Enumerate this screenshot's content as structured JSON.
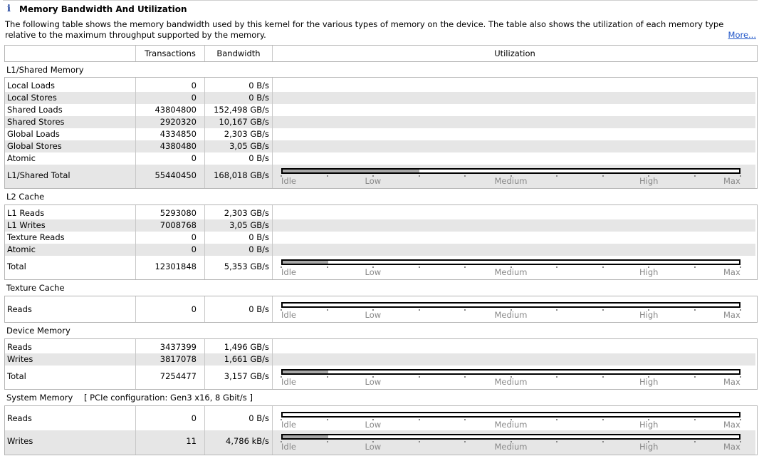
{
  "section": {
    "icon": "info-icon",
    "icon_glyph": "i",
    "title": "Memory Bandwidth And Utilization",
    "description": "The following table shows the memory bandwidth used by this kernel for the various types of memory on the device. The table also shows the utilization of each memory type relative to the maximum throughput supported by the memory.",
    "more_link": "More..."
  },
  "columns": {
    "transactions": "Transactions",
    "bandwidth": "Bandwidth",
    "utilization": "Utilization"
  },
  "scale_labels": {
    "idle": "Idle",
    "low": "Low",
    "medium": "Medium",
    "high": "High",
    "max": "Max"
  },
  "groups": {
    "l1": {
      "title": "L1/Shared Memory",
      "rows": [
        {
          "name": "Local Loads",
          "transactions": "0",
          "bandwidth": "0 B/s"
        },
        {
          "name": "Local Stores",
          "transactions": "0",
          "bandwidth": "0 B/s"
        },
        {
          "name": "Shared Loads",
          "transactions": "43804800",
          "bandwidth": "152,498 GB/s"
        },
        {
          "name": "Shared Stores",
          "transactions": "2920320",
          "bandwidth": "10,167 GB/s"
        },
        {
          "name": "Global Loads",
          "transactions": "4334850",
          "bandwidth": "2,303 GB/s"
        },
        {
          "name": "Global Stores",
          "transactions": "4380480",
          "bandwidth": "3,05 GB/s"
        },
        {
          "name": "Atomic",
          "transactions": "0",
          "bandwidth": "0 B/s"
        }
      ],
      "total": {
        "name": "L1/Shared Total",
        "transactions": "55440450",
        "bandwidth": "168,018 GB/s",
        "utilization": 0.3
      }
    },
    "l2": {
      "title": "L2 Cache",
      "rows": [
        {
          "name": "L1 Reads",
          "transactions": "5293080",
          "bandwidth": "2,303 GB/s"
        },
        {
          "name": "L1 Writes",
          "transactions": "7008768",
          "bandwidth": "3,05 GB/s"
        },
        {
          "name": "Texture Reads",
          "transactions": "0",
          "bandwidth": "0 B/s"
        },
        {
          "name": "Atomic",
          "transactions": "0",
          "bandwidth": "0 B/s"
        }
      ],
      "total": {
        "name": "Total",
        "transactions": "12301848",
        "bandwidth": "5,353 GB/s",
        "utilization": 0.1
      }
    },
    "tex": {
      "title": "Texture Cache",
      "total": {
        "name": "Reads",
        "transactions": "0",
        "bandwidth": "0 B/s",
        "utilization": 0
      }
    },
    "dev": {
      "title": "Device Memory",
      "rows": [
        {
          "name": "Reads",
          "transactions": "3437399",
          "bandwidth": "1,496 GB/s"
        },
        {
          "name": "Writes",
          "transactions": "3817078",
          "bandwidth": "1,661 GB/s"
        }
      ],
      "total": {
        "name": "Total",
        "transactions": "7254477",
        "bandwidth": "3,157 GB/s",
        "utilization": 0.1
      }
    },
    "sys": {
      "title": "System Memory",
      "pcie": "[ PCIe configuration: Gen3 x16, 8 Gbit/s ]",
      "reads": {
        "name": "Reads",
        "transactions": "0",
        "bandwidth": "0 B/s",
        "utilization": 0
      },
      "writes": {
        "name": "Writes",
        "transactions": "11",
        "bandwidth": "4,786 kB/s",
        "utilization": 0.1
      }
    }
  }
}
